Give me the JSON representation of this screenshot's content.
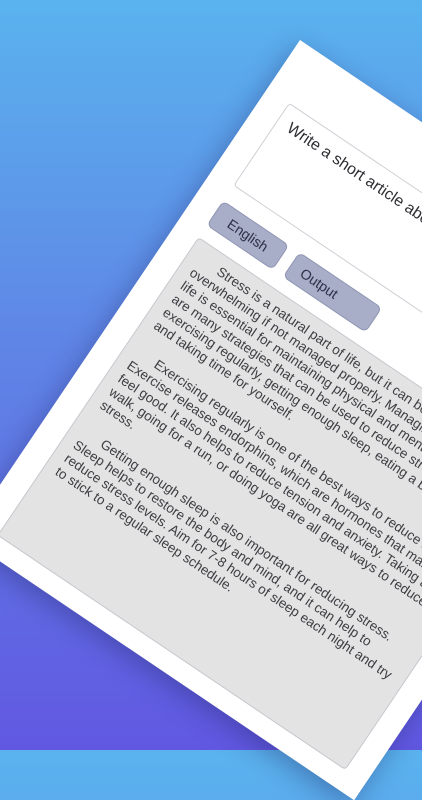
{
  "top_chip": {
    "label": ""
  },
  "prompt": {
    "text": "Write a short article about reducing stress in daily life."
  },
  "buttons": {
    "language": "English",
    "output": "Output"
  },
  "output": {
    "paragraphs": [
      "Stress is a natural part of life, but it can become overwhelming if not managed properly. Managing stress in daily life is essential for maintaining physical and mental health. There are many strategies that can be used to reduce stress, such as exercising regularly, getting enough sleep, eating a balanced diet, and taking time for yourself.",
      "Exercising regularly is one of the best ways to reduce stress. Exercise releases endorphins, which are hormones that make us feel good. It also helps to reduce tension and anxiety. Taking a walk, going for a run, or doing yoga are all great ways to reduce stress.",
      "Getting enough sleep is also important for reducing stress. Sleep helps to restore the body and mind, and it can help to reduce stress levels. Aim for 7-8 hours of sleep each night and try to stick to a regular sleep schedule."
    ]
  }
}
